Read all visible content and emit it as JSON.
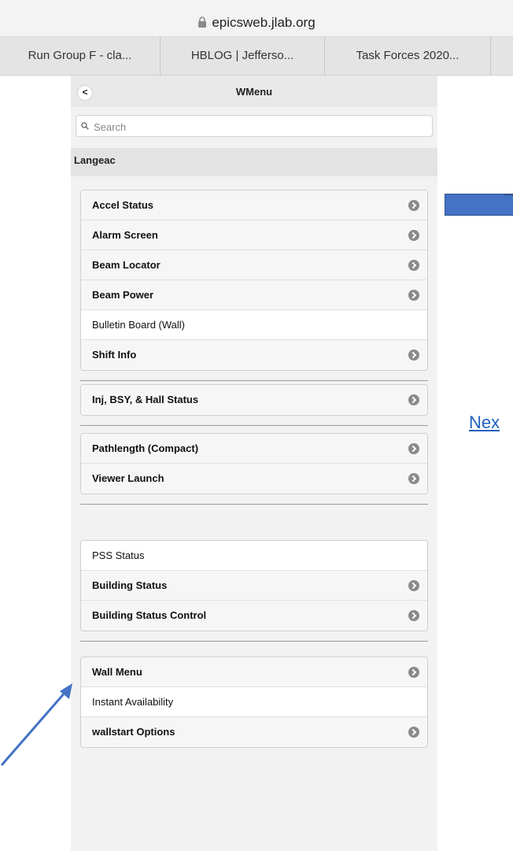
{
  "browser": {
    "url": "epicsweb.jlab.org",
    "tabs": [
      "Run Group F - cla...",
      "HBLOG | Jefferso...",
      "Task Forces 2020..."
    ]
  },
  "wmenu": {
    "title": "WMenu",
    "back_label": "<",
    "search_placeholder": "Search",
    "section": "Langeac",
    "groups": [
      [
        {
          "label": "Accel Status",
          "bold": true,
          "chevron": true
        },
        {
          "label": "Alarm Screen",
          "bold": true,
          "chevron": true
        },
        {
          "label": "Beam Locator",
          "bold": true,
          "chevron": true
        },
        {
          "label": "Beam Power",
          "bold": true,
          "chevron": true
        },
        {
          "label": "Bulletin Board (Wall)",
          "bold": false,
          "chevron": false
        },
        {
          "label": "Shift Info",
          "bold": true,
          "chevron": true
        }
      ],
      [
        {
          "label": "Inj, BSY, & Hall Status",
          "bold": true,
          "chevron": true
        }
      ],
      [
        {
          "label": "Pathlength (Compact)",
          "bold": true,
          "chevron": true
        },
        {
          "label": "Viewer Launch",
          "bold": true,
          "chevron": true
        }
      ],
      [
        {
          "label": "PSS Status",
          "bold": false,
          "chevron": false
        },
        {
          "label": "Building Status",
          "bold": true,
          "chevron": true
        },
        {
          "label": "Building Status Control",
          "bold": true,
          "chevron": true
        }
      ],
      [
        {
          "label": "Wall Menu",
          "bold": true,
          "chevron": true
        },
        {
          "label": "Instant Availability",
          "bold": false,
          "chevron": false
        },
        {
          "label": "wallstart Options",
          "bold": true,
          "chevron": true
        }
      ]
    ]
  },
  "overlay": {
    "next_link": "Nex"
  },
  "colors": {
    "accent_blue": "#4472c4",
    "link_blue": "#1f5fbf"
  }
}
